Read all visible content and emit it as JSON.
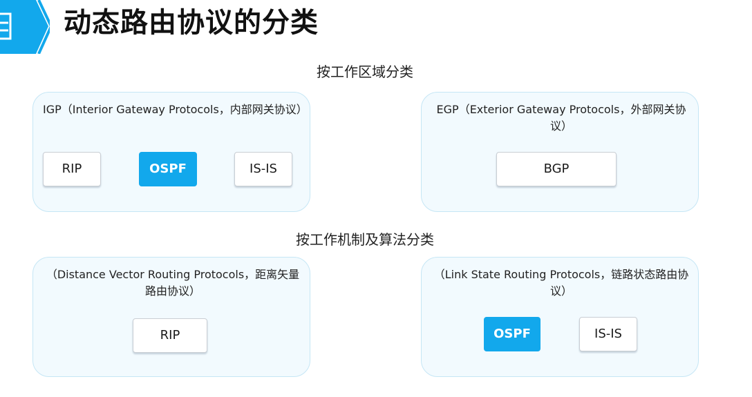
{
  "page": {
    "title": "动态路由协议的分类"
  },
  "colors": {
    "accent": "#12a8ec",
    "panel_background": "#f2fafe",
    "panel_border": "#c5e6f5",
    "button_border": "#c9ced4"
  },
  "icons": {
    "title_badge": "document-icon"
  },
  "by_area": {
    "heading": "按工作区域分类",
    "igp": {
      "title": "IGP（Interior Gateway Protocols，内部网关协议）",
      "protocols": [
        "RIP",
        "OSPF",
        "IS-IS"
      ]
    },
    "egp": {
      "title": "EGP（Exterior Gateway Protocols，外部网关协议）",
      "protocols": [
        "BGP"
      ]
    }
  },
  "by_mechanism": {
    "heading": "按工作机制及算法分类",
    "distance_vector": {
      "title": "（Distance Vector Routing Protocols，距离矢量路由协议）",
      "protocols": [
        "RIP"
      ]
    },
    "link_state": {
      "title": "（Link State Routing Protocols，链路状态路由协议）",
      "protocols": [
        "OSPF",
        "IS-IS"
      ]
    }
  }
}
